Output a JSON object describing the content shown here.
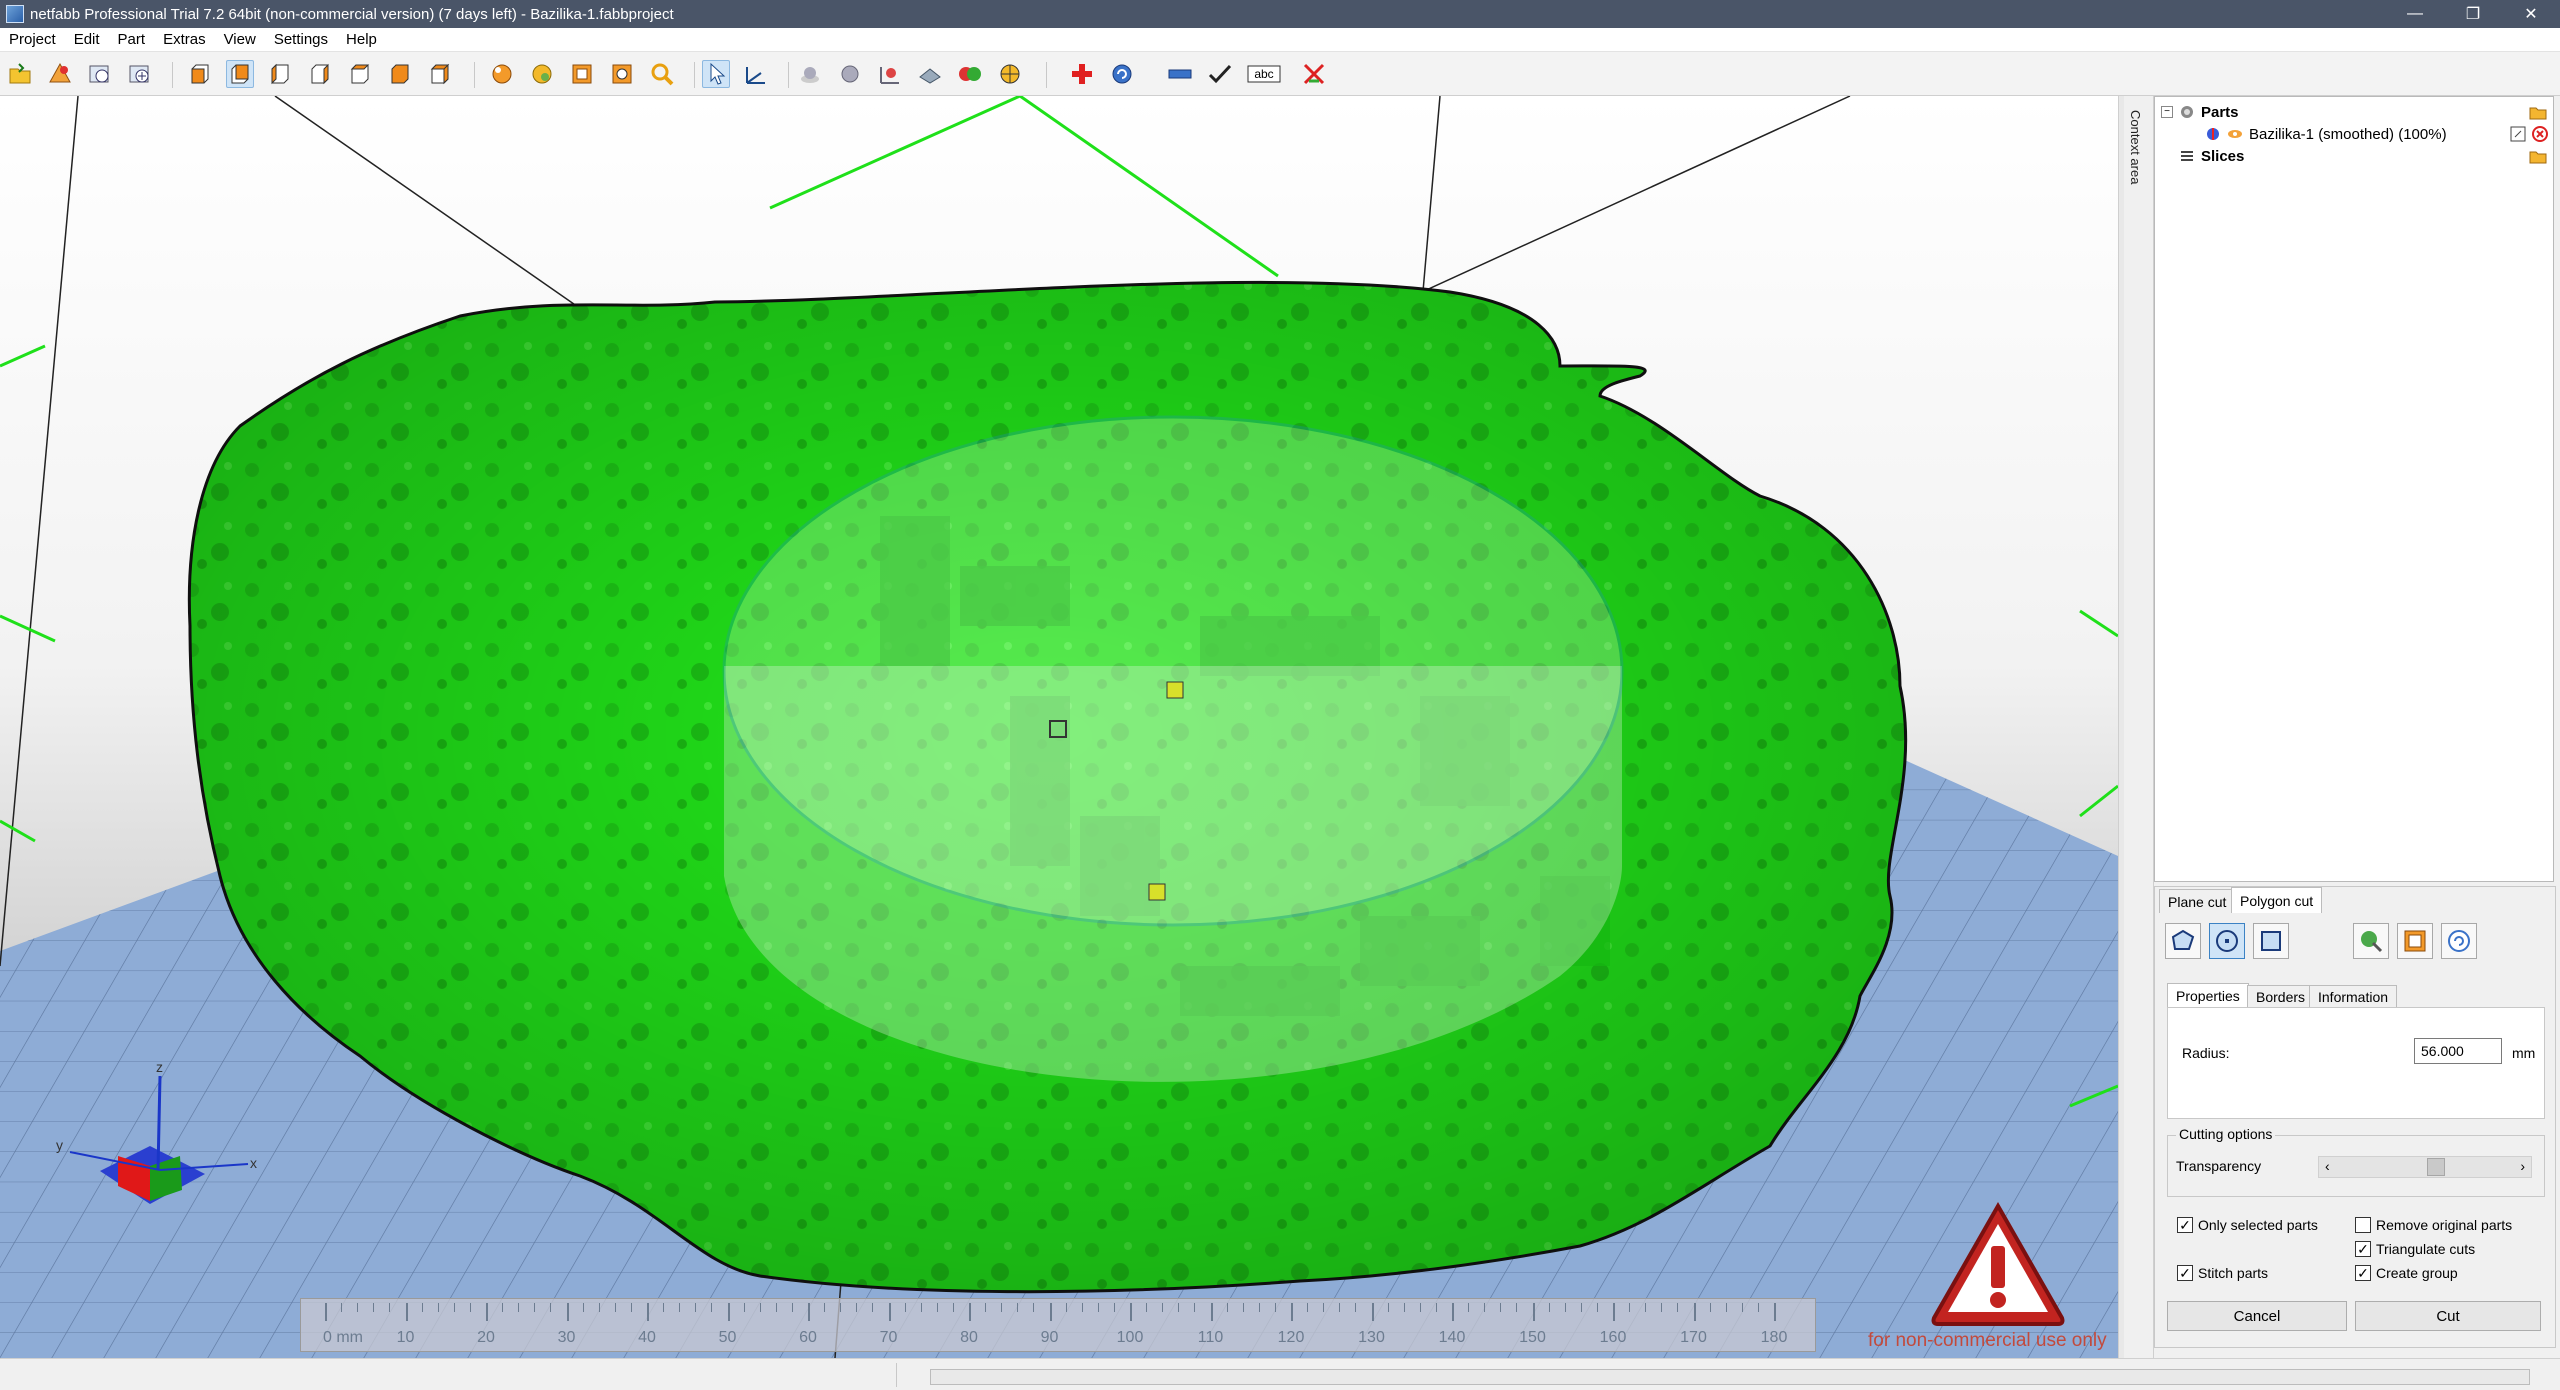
{
  "window": {
    "title": "netfabb Professional Trial 7.2 64bit (non-commercial version) (7 days left) - Bazilika-1.fabbproject",
    "controls": [
      "—",
      "❐",
      "✕"
    ]
  },
  "menu": [
    "Project",
    "Edit",
    "Part",
    "Extras",
    "View",
    "Settings",
    "Help"
  ],
  "toolbar": {
    "icons": [
      "open-project-icon",
      "add-part-icon",
      "repair-icon",
      "add-part-2-icon",
      "view-front-icon",
      "view-back-icon",
      "view-left-icon",
      "view-right-icon",
      "view-top-icon",
      "view-bottom-icon",
      "view-3d-icon",
      "zoom-all-icon",
      "zoom-selection-icon",
      "zoom-part-icon",
      "magnifier-icon",
      "select-tool-icon",
      "move-tool-icon",
      "measure-point-icon",
      "measure-sphere-icon",
      "measure-dimension-icon",
      "plane-icon",
      "boolean-icon",
      "section-icon",
      "repair-cross-icon",
      "rotate-icon",
      "ruler-icon",
      "checkmark-icon",
      "label-abc-icon",
      "no-printing-icon"
    ]
  },
  "viewport": {
    "ruler": {
      "labels": [
        "0 mm",
        "10",
        "20",
        "30",
        "40",
        "50",
        "60",
        "70",
        "80",
        "90",
        "100",
        "110",
        "120",
        "130",
        "140",
        "150",
        "160",
        "170",
        "180"
      ]
    },
    "axes": {
      "x": "x",
      "y": "y",
      "z": "z"
    },
    "watermark": "for non-commercial use only"
  },
  "context_area": {
    "label": "Context area"
  },
  "tree": {
    "parts_label": "Parts",
    "part_item": "Bazilika-1 (smoothed) (100%)",
    "slices_label": "Slices"
  },
  "cut_panel": {
    "tabs": [
      "Plane cut",
      "Polygon cut"
    ],
    "sub_tabs": [
      "Properties",
      "Borders",
      "Information"
    ],
    "radius_label": "Radius:",
    "radius_value": "56.000",
    "radius_unit": "mm",
    "cutting_options_label": "Cutting options",
    "transparency_label": "Transparency",
    "checks": {
      "only_selected": {
        "label": "Only selected parts",
        "checked": true
      },
      "remove_original": {
        "label": "Remove original parts",
        "checked": false
      },
      "triangulate": {
        "label": "Triangulate cuts",
        "checked": true
      },
      "stitch": {
        "label": "Stitch parts",
        "checked": true
      },
      "create_group": {
        "label": "Create group",
        "checked": true
      }
    },
    "cancel_label": "Cancel",
    "cut_label": "Cut"
  },
  "colors": {
    "mesh_green": "#22e81a",
    "platform_blue": "#8eacd6",
    "cut_circle": "#1e88d8",
    "title_bar": "#4a5568"
  }
}
